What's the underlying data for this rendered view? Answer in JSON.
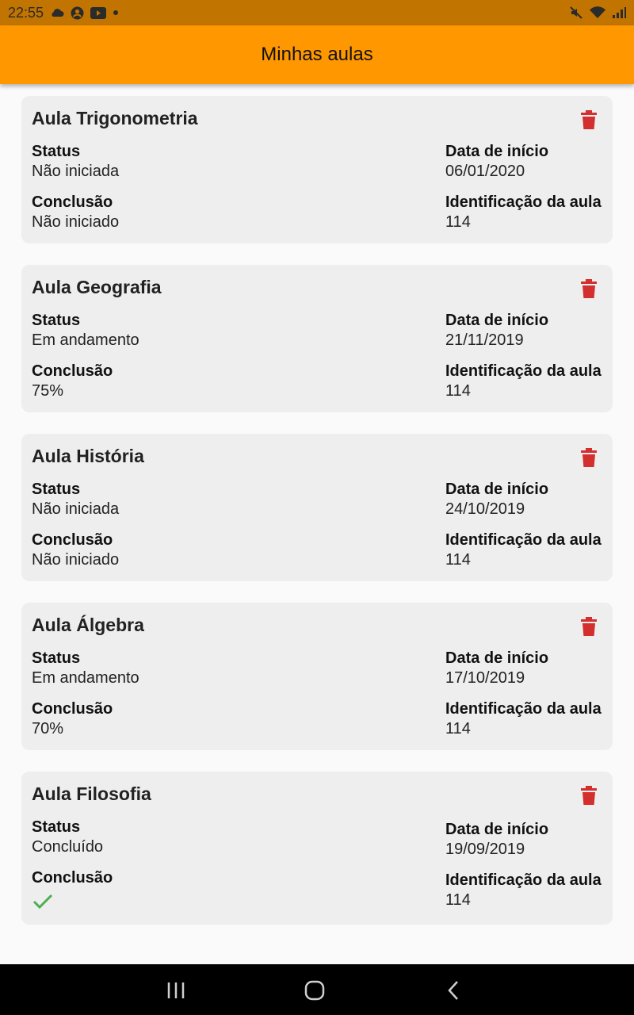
{
  "status_bar": {
    "time": "22:55",
    "left_icons": [
      "cloud-icon",
      "account-circle-icon",
      "youtube-icon",
      "dot-icon"
    ],
    "right_icons": [
      "mute-icon",
      "wifi-icon",
      "signal-icon"
    ]
  },
  "app_bar": {
    "title": "Minhas aulas",
    "color": "#ff9800"
  },
  "labels": {
    "status": "Status",
    "start_date": "Data de início",
    "conclusion": "Conclusão",
    "class_id": "Identificação da aula"
  },
  "classes": [
    {
      "title": "Aula Trigonometria",
      "status": "Não iniciada",
      "start_date": "06/01/2020",
      "conclusion": "Não iniciado",
      "class_id": "114"
    },
    {
      "title": "Aula Geografia",
      "status": "Em andamento",
      "start_date": "21/11/2019",
      "conclusion": "75%",
      "class_id": "114"
    },
    {
      "title": "Aula História",
      "status": "Não iniciada",
      "start_date": "24/10/2019",
      "conclusion": "Não iniciado",
      "class_id": "114"
    },
    {
      "title": "Aula Álgebra",
      "status": "Em andamento",
      "start_date": "17/10/2019",
      "conclusion": "70%",
      "class_id": "114"
    },
    {
      "title": "Aula Filosofia",
      "status": "Concluído",
      "start_date": "19/09/2019",
      "conclusion_icon": "check-icon",
      "class_id": "114"
    }
  ],
  "colors": {
    "delete": "#d32f2f",
    "check": "#4caf50",
    "card": "#eeeeee"
  },
  "nav_bar": {
    "icons": [
      "recent-apps-icon",
      "home-icon",
      "back-icon"
    ]
  }
}
